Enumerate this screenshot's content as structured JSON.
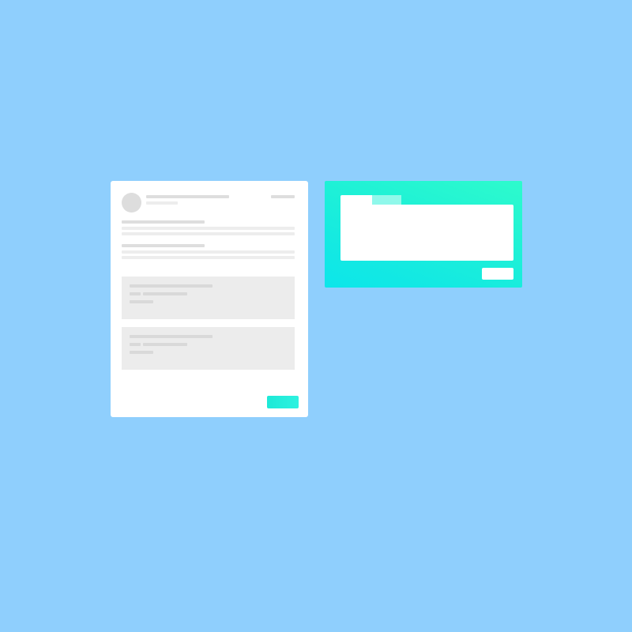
{
  "theme": {
    "background": "#8fcffd",
    "card_background": "#ffffff",
    "accent_gradient": [
      "#0ce6ea",
      "#2efbcc"
    ],
    "placeholder_gray": "#dedede",
    "sub_box_background": "#ececec"
  },
  "message_card": {
    "avatar": "avatar",
    "sections": 2,
    "attachments": 2,
    "action_button": "accent-button"
  },
  "composer_card": {
    "tabs": [
      "active-tab",
      "inactive-tab"
    ],
    "textarea_value": "",
    "action_button": "white-button"
  }
}
